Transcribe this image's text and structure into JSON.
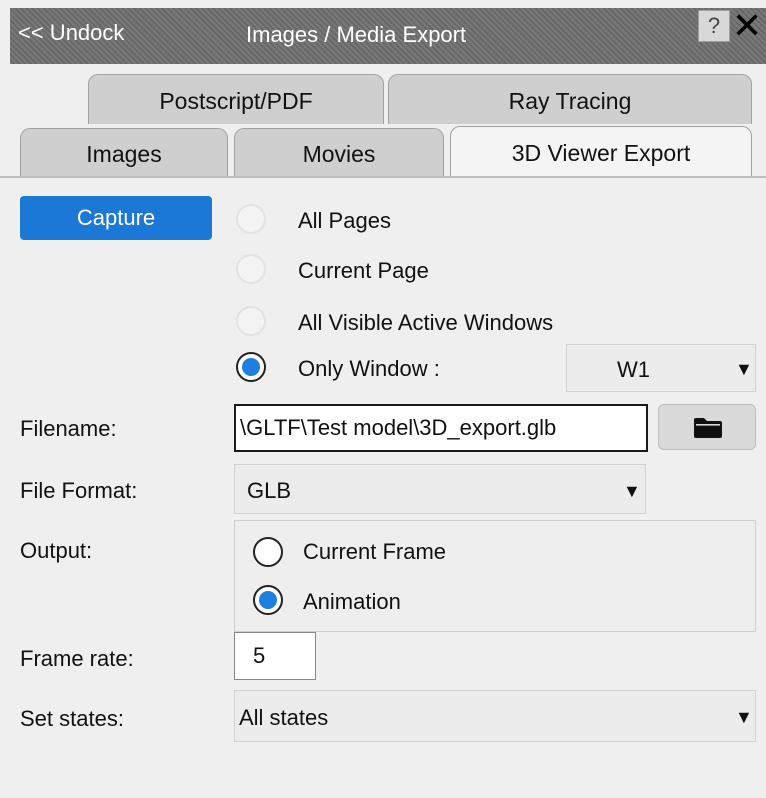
{
  "titlebar": {
    "undock": "<< Undock",
    "title": "Images / Media Export",
    "help": "?",
    "close": "✕"
  },
  "tabs": {
    "row1": [
      "Postscript/PDF",
      "Ray Tracing"
    ],
    "row2": [
      "Images",
      "Movies",
      "3D Viewer Export"
    ],
    "active": "3D Viewer Export"
  },
  "capture": {
    "button_label": "Capture",
    "options": [
      "All Pages",
      "Current Page",
      "All Visible Active Windows",
      "Only Window :"
    ],
    "selected": "Only Window :",
    "window_select": "W1"
  },
  "filename": {
    "label": "Filename:",
    "value": "\\GLTF\\Test model\\3D_export.glb"
  },
  "file_format": {
    "label": "File Format:",
    "value": "GLB"
  },
  "output": {
    "label": "Output:",
    "options": [
      "Current Frame",
      "Animation"
    ],
    "selected": "Animation"
  },
  "frame_rate": {
    "label": "Frame rate:",
    "value": "5"
  },
  "set_states": {
    "label": "Set states:",
    "value": "All states"
  },
  "colors": {
    "accent": "#1b78d6",
    "titlebar": "#6f6f6f"
  },
  "icons": {
    "dropdown": "caret-down-icon",
    "browse": "folder-icon"
  }
}
